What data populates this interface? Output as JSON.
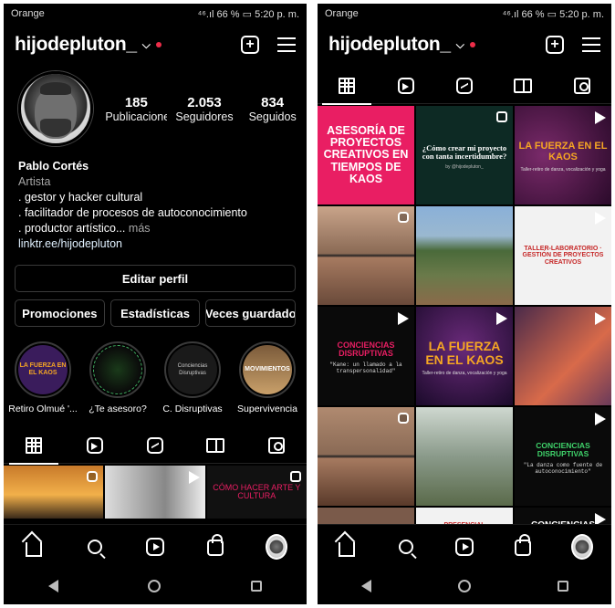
{
  "status": {
    "carrier": "Orange",
    "right": "⁴⁶.ıl 66 % ▭ 5:20 p. m."
  },
  "profile": {
    "username": "hijodepluton_",
    "stats": [
      {
        "num": "185",
        "label": "Publicaciones"
      },
      {
        "num": "2.053",
        "label": "Seguidores"
      },
      {
        "num": "834",
        "label": "Seguidos"
      }
    ],
    "name": "Pablo Cortés",
    "category": "Artista",
    "bio": [
      ". gestor y hacker cultural",
      ". facilitador de procesos de autoconocimiento",
      ". productor artístico..."
    ],
    "more": "más",
    "link": "linktr.ee/hijodepluton",
    "edit_label": "Editar perfil",
    "buttons": [
      "Promociones",
      "Estadísticas",
      "Veces guardado"
    ]
  },
  "highlights": [
    {
      "label": "Retiro Olmué '...",
      "cover": "LA FUERZA EN EL KAOS"
    },
    {
      "label": "¿Te asesoro?",
      "cover": ""
    },
    {
      "label": "C. Disruptivas",
      "cover": "Conciencias Disruptivas"
    },
    {
      "label": "Supervivencia",
      "cover": "MOVIMIENTOS"
    }
  ],
  "left_posts": [
    {
      "text": "",
      "badge": "reel"
    },
    {
      "text": "",
      "badge": "play"
    },
    {
      "text": "CÓMO HACER ARTE Y CULTURA",
      "badge": "multi"
    }
  ],
  "right_posts": [
    {
      "text": "ASESORÍA DE PROYECTOS CREATIVOS EN TIEMPOS DE KAOS",
      "badge": ""
    },
    {
      "text": "¿Cómo crear mi proyecto con tanta incertidumbre?",
      "sub": "by @hijodepluton_",
      "badge": "multi"
    },
    {
      "text": "LA FUERZA EN EL KAOS",
      "sub": "Taller-retiro de danza, vocalización y yoga",
      "badge": "play"
    },
    {
      "text": "",
      "badge": "reel"
    },
    {
      "text": "",
      "badge": ""
    },
    {
      "text": "TALLER-LABORATORIO · GESTIÓN DE PROYECTOS CREATIVOS",
      "badge": "play"
    },
    {
      "text": "CONCIENCIAS DISRUPTIVAS",
      "sub": "\"Kane: un llamado a la transpersonalidad\"",
      "badge": "play"
    },
    {
      "text": "LA FUERZA EN EL KAOS",
      "sub": "Taller-retiro de danza, vocalización y yoga",
      "badge": "play"
    },
    {
      "text": "",
      "badge": "play"
    },
    {
      "text": "",
      "badge": "reel"
    },
    {
      "text": "",
      "badge": ""
    },
    {
      "text": "CONCIENCIAS DISRUPTIVAS",
      "sub": "\"La danza como fuente de autoconocimiento\"",
      "badge": "play"
    },
    {
      "text": "",
      "badge": ""
    },
    {
      "text": "PRESENCIAL",
      "badge": ""
    },
    {
      "text": "CONCIENCIAS",
      "badge": "play"
    }
  ],
  "colors": {
    "bg": "#000000",
    "accent_red": "#ed2d49",
    "pink": "#e91e63",
    "orange_text": "#f5a623"
  }
}
